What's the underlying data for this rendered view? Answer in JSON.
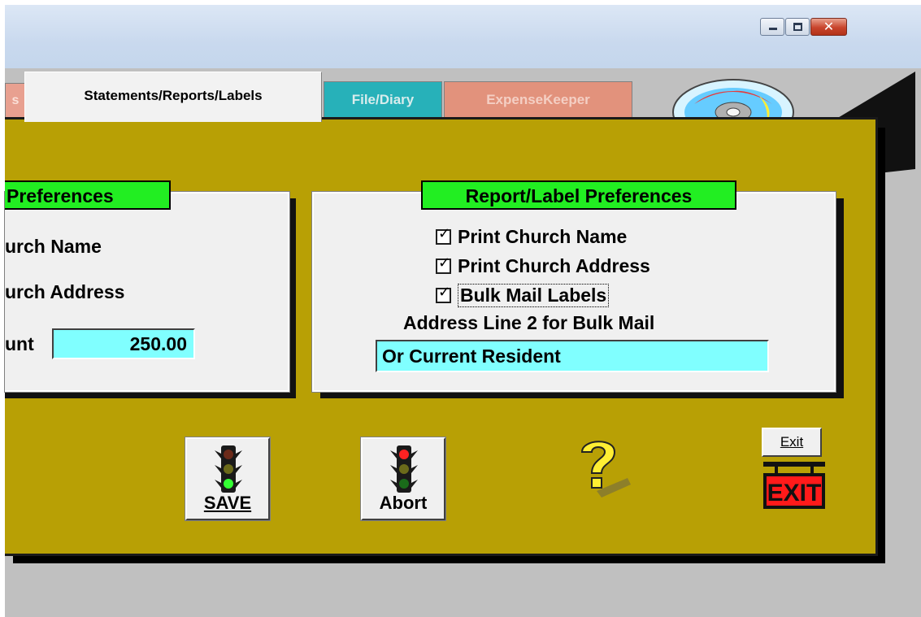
{
  "window": {
    "minimize_icon": "minimize-icon",
    "maximize_icon": "maximize-icon",
    "close_glyph": "✕"
  },
  "tabs": {
    "prev_fragment": "s",
    "active": "Statements/Reports/Labels",
    "file": "File/Diary",
    "expense": "ExpenseKeeper"
  },
  "left_group": {
    "title": "Preferences",
    "line1": "urch Name",
    "line2": "urch Address",
    "amount_label": "unt",
    "amount_value": "250.00"
  },
  "right_group": {
    "title": "Report/Label Preferences",
    "check1": "Print Church Name",
    "check2": "Print Church Address",
    "check3": "Bulk Mail Labels",
    "addr2_label": "Address Line 2 for Bulk Mail",
    "addr2_value": "Or Current Resident"
  },
  "buttons": {
    "save_label": "SAVE",
    "abort_label": "Abort",
    "exit_label": "Exit",
    "exit_sign": "EXIT"
  },
  "colors": {
    "panel": "#b8a005",
    "title_green": "#22ee22",
    "field_cyan": "#80ffff",
    "tab_file": "#27b1b9",
    "tab_expense": "#e2927c"
  }
}
